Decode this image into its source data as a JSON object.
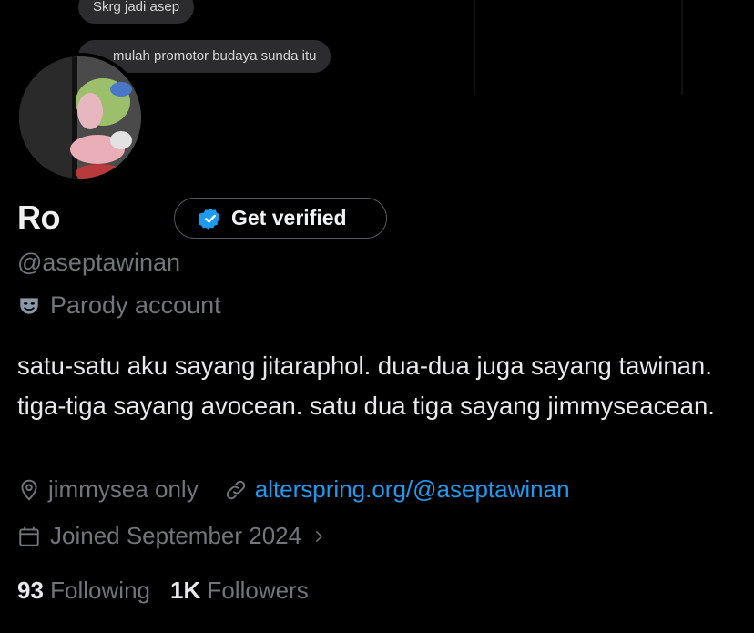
{
  "banner": {
    "bubbles": [
      "Skrg jadi asep",
      "mulah promotor budaya sunda itu"
    ]
  },
  "profile": {
    "name": "Ro",
    "verify_label": "Get verified",
    "handle": "@aseptawinan",
    "parody_label": "Parody account",
    "bio": "satu-satu aku sayang jitaraphol. dua-dua juga sayang tawinan. tiga-tiga sayang avocean. satu dua tiga sayang jimmyseacean.",
    "location": "jimmysea only",
    "website": "alterspring.org/@aseptawinan",
    "joined": "Joined September 2024"
  },
  "stats": {
    "following_count": "93",
    "following_label": "Following",
    "followers_count": "1K",
    "followers_label": "Followers"
  },
  "colors": {
    "background": "#000000",
    "link": "#1d9bf0",
    "verified_badge": "#1d9bf0",
    "muted": "#71767b"
  },
  "icons": [
    "verified-badge-icon",
    "theater-mask-icon",
    "location-pin-icon",
    "link-icon",
    "calendar-icon",
    "chevron-right-icon"
  ]
}
